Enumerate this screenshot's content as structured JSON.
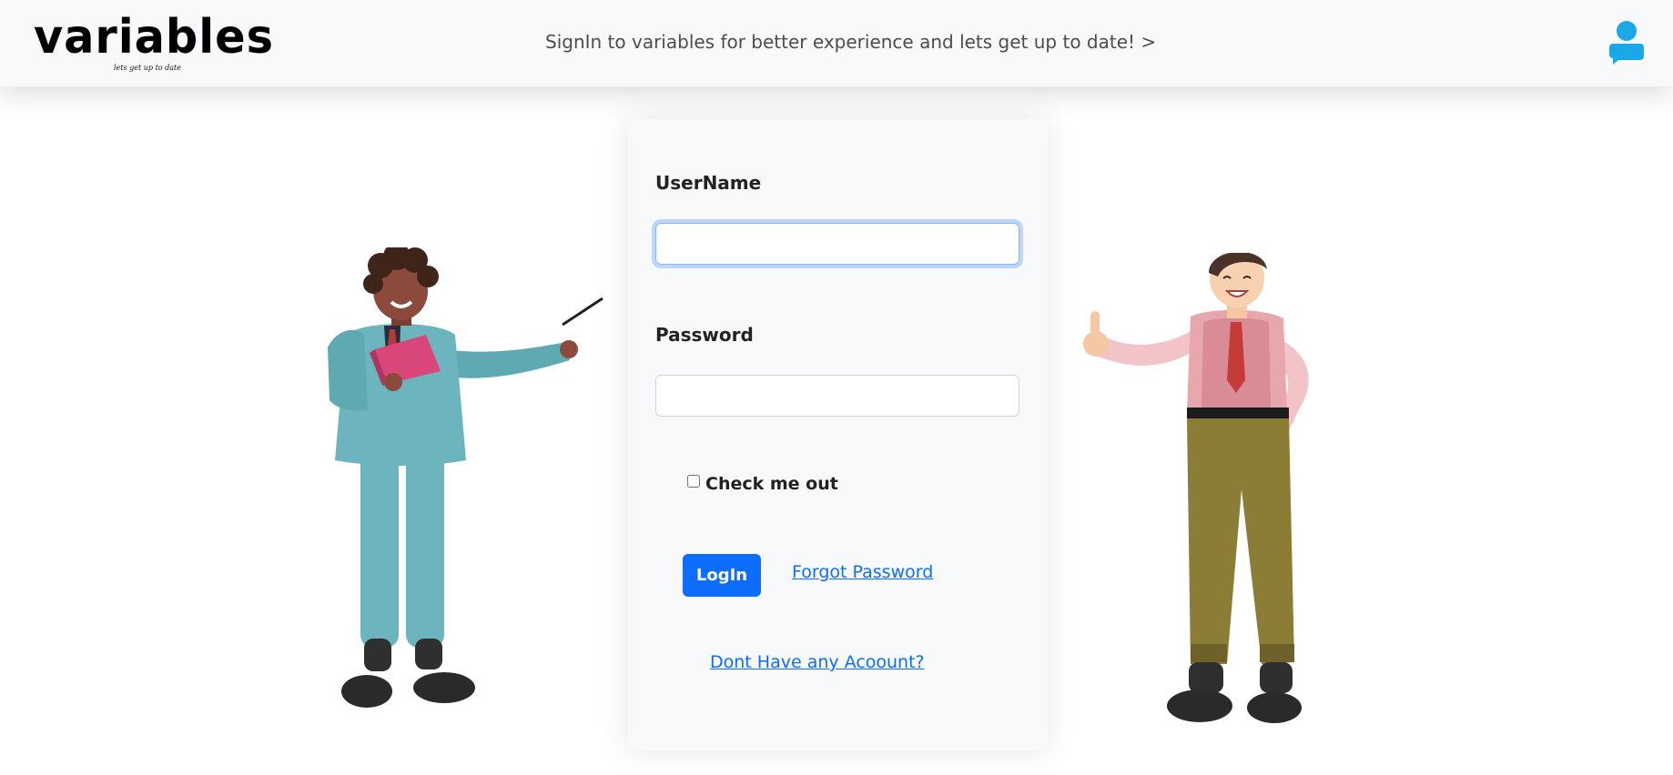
{
  "navbar": {
    "brand_name": "variables",
    "brand_tagline": "lets get up to date",
    "message": "SignIn to variables for better experience and lets get up to date! >",
    "user_icon": "user-icon",
    "accent_color": "#1aa8e8"
  },
  "login_form": {
    "username_label": "UserName",
    "username_value": "",
    "password_label": "Password",
    "password_value": "",
    "remember_label": "Check me out",
    "remember_checked": false,
    "login_button": "LogIn",
    "forgot_password_link": "Forgot Password",
    "register_link": "Dont Have any Acoount?",
    "button_color": "#0d6efd",
    "link_color": "#0d6efd"
  },
  "illustrations": {
    "left": "teacher-with-pointer-illustration",
    "right": "man-thumbs-up-illustration"
  }
}
